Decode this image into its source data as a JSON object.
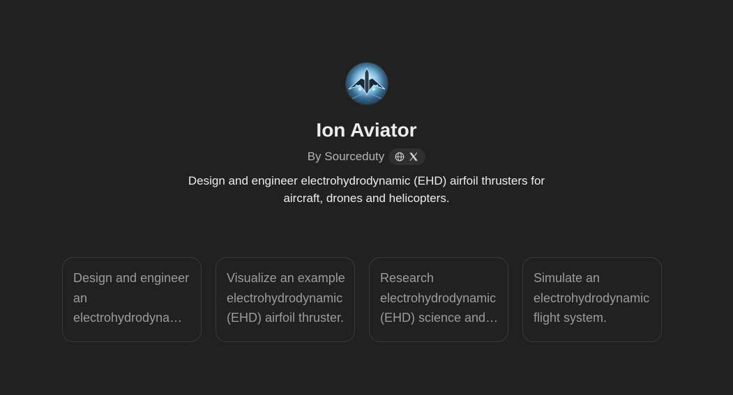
{
  "gpt": {
    "name": "Ion Aviator",
    "byline": "By Sourceduty",
    "description": "Design and engineer electrohydrodynamic (EHD) airfoil thrusters for aircraft, drones and helicopters.",
    "avatar_icon": "ehd-aircraft-avatar",
    "links": [
      {
        "icon": "globe-icon"
      },
      {
        "icon": "x-logo-icon"
      }
    ]
  },
  "conversation_starters": [
    {
      "text": "Design and engineer an electrohydrodynamic (EHD) airfoil thruster."
    },
    {
      "text": "Visualize an example electrohydrodynamic (EHD) airfoil thruster."
    },
    {
      "text": "Research electrohydrodynamic (EHD) science and engineering."
    },
    {
      "text": "Simulate an electrohydrodynamic flight system."
    }
  ],
  "colors": {
    "background": "#212121",
    "title": "#ececec",
    "muted": "#b4b4b4",
    "starter_text": "#9b9b9b",
    "starter_border": "#3a3a3a"
  }
}
